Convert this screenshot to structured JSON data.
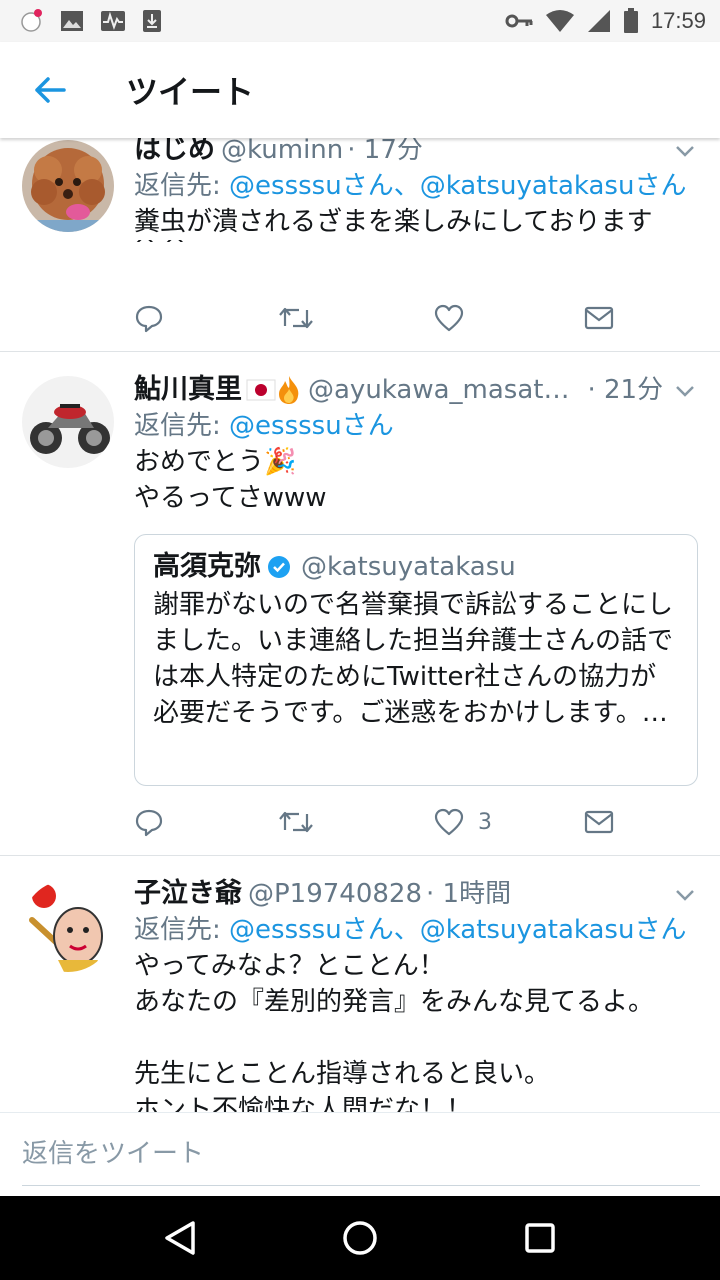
{
  "status_bar": {
    "time": "17:59"
  },
  "header": {
    "title": "ツイート"
  },
  "tweets": [
    {
      "name": "はじめ",
      "handle": "@kuminn",
      "time": "· 17分",
      "reply_prefix": "返信先: ",
      "reply_mentions": "@essssuさん、@katsuyatakasuさん",
      "text": "糞虫が潰されるざまを楽しみにしております\n^ ^",
      "likes": ""
    },
    {
      "name": "鮎川真里",
      "flag_emoji": "🇯🇵",
      "fire_emoji": "🔥",
      "handle": "@ayukawa_masat…",
      "time": "· 21分",
      "reply_prefix": "返信先: ",
      "reply_mentions": "@essssuさん",
      "text": "おめでとう🎉\nやるってさwww",
      "likes": "3",
      "quote": {
        "name": "高須克弥",
        "handle": "@katsuyatakasu",
        "text": "謝罪がないので名誉棄損で訴訟することにしました。いま連絡した担当弁護士さんの話では本人特定のためにTwitter社さんの協力が必要だそうです。ご迷惑をおかけします。…"
      }
    },
    {
      "name": "子泣き爺",
      "handle": "@P19740828",
      "time": "· 1時間",
      "reply_prefix": "返信先: ",
      "reply_mentions": "@essssuさん、@katsuyatakasuさん",
      "text": "やってみなよ？とことん！\nあなたの『差別的発言』をみんな見てるよ。\n\n先生にとことん指導されると良い。\nホント不愉快な人間だな！！",
      "likes": ""
    }
  ],
  "composer": {
    "placeholder": "返信をツイート"
  },
  "colors": {
    "accent": "#1b95e0",
    "muted": "#657786",
    "nav": "#000000"
  },
  "icons": [
    "back-arrow-icon",
    "reply-icon",
    "retweet-icon",
    "like-icon",
    "dm-icon",
    "caret-down-icon",
    "verified-icon"
  ]
}
